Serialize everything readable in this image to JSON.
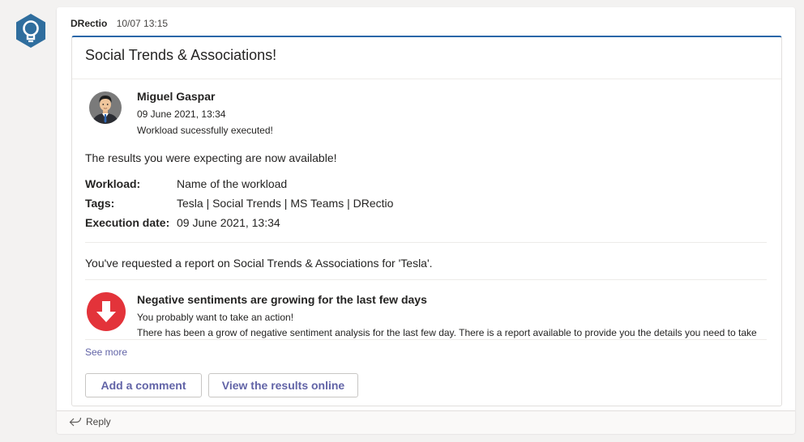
{
  "message": {
    "sender": "DRectio",
    "timestamp": "10/07 13:15"
  },
  "card": {
    "title": "Social Trends & Associations!",
    "person": {
      "name": "Miguel Gaspar",
      "date": "09 June 2021, 13:34",
      "status": "Workload sucessfully executed!"
    },
    "results_text": "The results you were expecting are now available!",
    "facts": [
      {
        "label": "Workload:",
        "value": "Name of the workload"
      },
      {
        "label": "Tags:",
        "value": "Tesla | Social Trends | MS Teams | DRectio"
      },
      {
        "label": "Execution date:",
        "value": "09 June 2021, 13:34"
      }
    ],
    "request_text": "You've requested a report on Social Trends & Associations for 'Tesla'.",
    "alert": {
      "title": "Negative sentiments are growing for the last few days",
      "subtitle": "You probably want to take an action!",
      "body": "There has been a grow of negative sentiment analysis for the last few day. There is a report available to provide you the details you need to take",
      "icon": "arrow-down-circle-icon",
      "color": "#e3333a"
    },
    "see_more": "See more",
    "buttons": {
      "add_comment": "Add a comment",
      "view_results": "View the results online"
    }
  },
  "reply": {
    "label": "Reply"
  },
  "colors": {
    "accent": "#6264a7",
    "card_top_border": "#2a66a8",
    "bot_avatar": "#2f6e9e"
  }
}
